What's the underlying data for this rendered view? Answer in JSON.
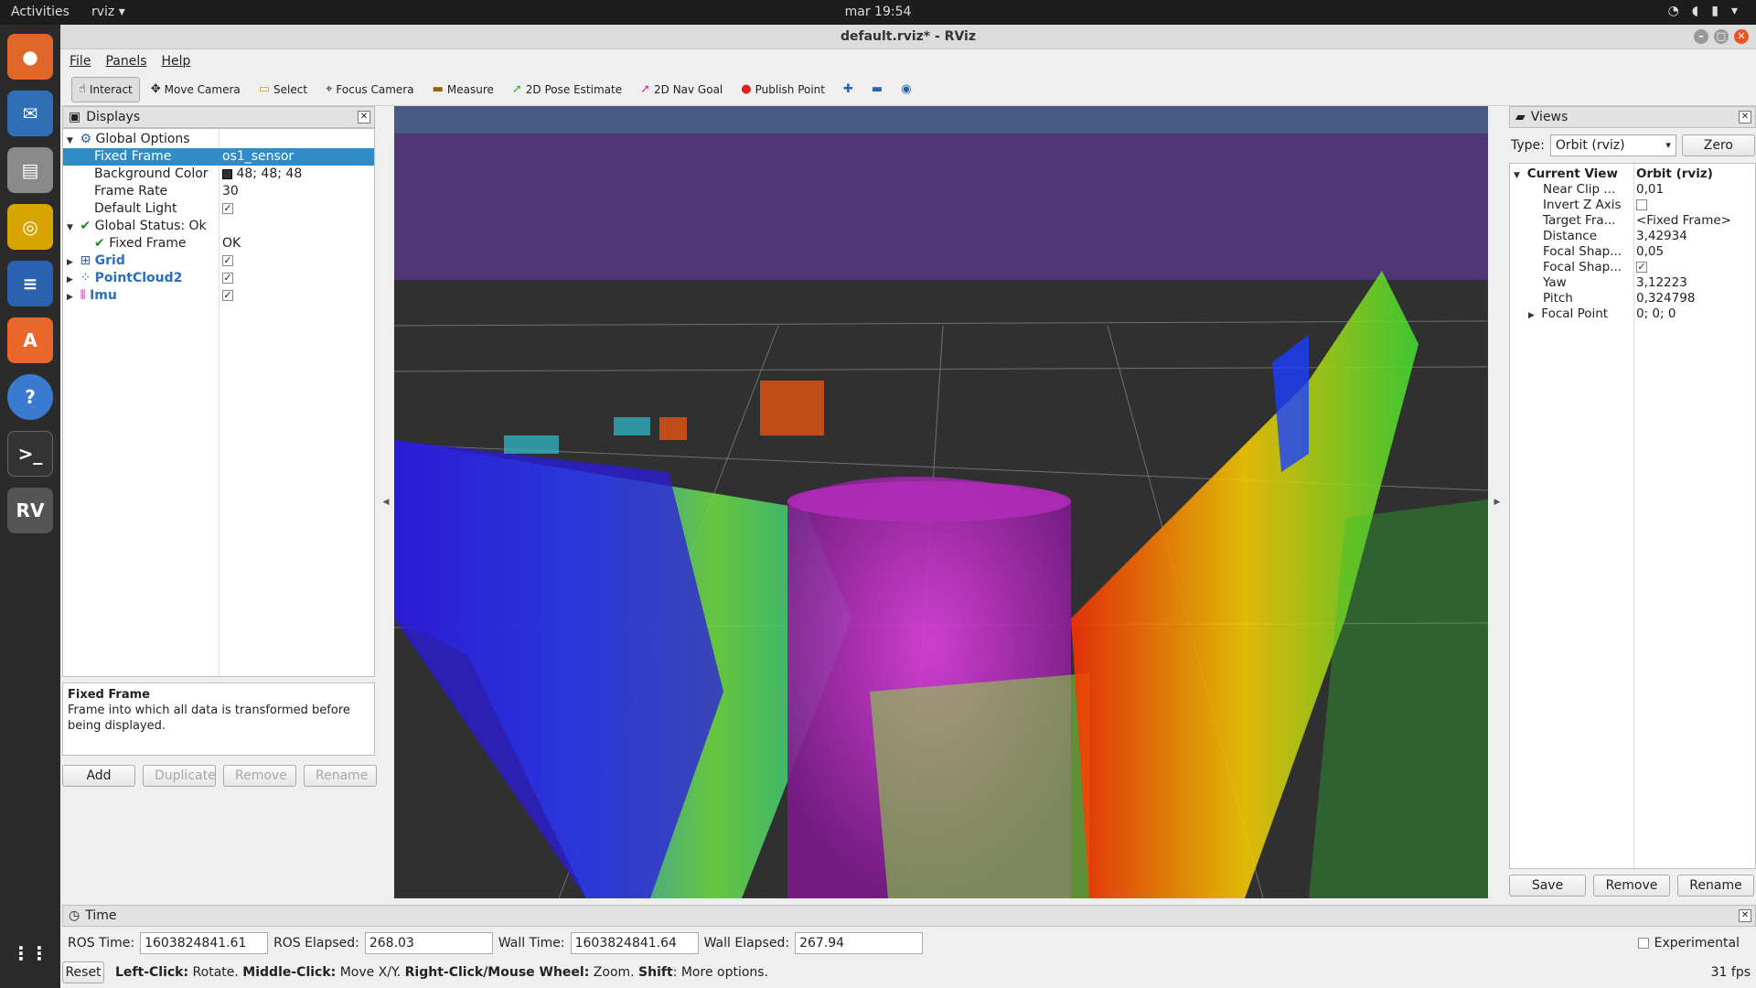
{
  "topbar": {
    "activities": "Activities",
    "app_name": "rviz",
    "clock": "mar 19:54"
  },
  "window": {
    "title": "default.rviz* - RViz"
  },
  "menu": [
    "File",
    "Panels",
    "Help"
  ],
  "toolbar": {
    "interact": "Interact",
    "move_camera": "Move Camera",
    "select": "Select",
    "focus_camera": "Focus Camera",
    "measure": "Measure",
    "pose_estimate": "2D Pose Estimate",
    "nav_goal": "2D Nav Goal",
    "publish_point": "Publish Point"
  },
  "displays": {
    "title": "Displays",
    "global_options": "Global Options",
    "fixed_frame_label": "Fixed Frame",
    "fixed_frame_value": "os1_sensor",
    "bg_color_label": "Background Color",
    "bg_color_value": "48; 48; 48",
    "bg_color_hex": "#303030",
    "frame_rate_label": "Frame Rate",
    "frame_rate_value": "30",
    "default_light_label": "Default Light",
    "global_status": "Global Status: Ok",
    "status_fixed_frame": "Fixed Frame",
    "status_value": "OK",
    "grid": "Grid",
    "pointcloud": "PointCloud2",
    "imu": "Imu",
    "desc_title": "Fixed Frame",
    "desc_text": "Frame into which all data is transformed before being displayed.",
    "btn_add": "Add",
    "btn_duplicate": "Duplicate",
    "btn_remove": "Remove",
    "btn_rename": "Rename"
  },
  "views": {
    "title": "Views",
    "type_label": "Type:",
    "type_value": "Orbit (rviz)",
    "zero": "Zero",
    "current_view": "Current View",
    "current_view_value": "Orbit (rviz)",
    "props": [
      {
        "k": "Near Clip ...",
        "v": "0,01"
      },
      {
        "k": "Invert Z Axis",
        "v": ""
      },
      {
        "k": "Target Fra...",
        "v": "<Fixed Frame>"
      },
      {
        "k": "Distance",
        "v": "3,42934"
      },
      {
        "k": "Focal Shap...",
        "v": "0,05"
      },
      {
        "k": "Focal Shap...",
        "v": ""
      },
      {
        "k": "Yaw",
        "v": "3,12223"
      },
      {
        "k": "Pitch",
        "v": "0,324798"
      },
      {
        "k": "Focal Point",
        "v": "0; 0; 0"
      }
    ],
    "btn_save": "Save",
    "btn_remove": "Remove",
    "btn_rename": "Rename"
  },
  "time": {
    "title": "Time",
    "ros_time_label": "ROS Time:",
    "ros_time": "1603824841.61",
    "ros_elapsed_label": "ROS Elapsed:",
    "ros_elapsed": "268.03",
    "wall_time_label": "Wall Time:",
    "wall_time": "1603824841.64",
    "wall_elapsed_label": "Wall Elapsed:",
    "wall_elapsed": "267.94",
    "experimental": "Experimental",
    "reset": "Reset",
    "hint_left_b": "Left-Click:",
    "hint_left": "Rotate.",
    "hint_mid_b": "Middle-Click:",
    "hint_mid": "Move X/Y.",
    "hint_right_b": "Right-Click/Mouse Wheel:",
    "hint_right": "Zoom.",
    "hint_shift_b": "Shift",
    "hint_shift": ": More options.",
    "fps": "31 fps"
  }
}
